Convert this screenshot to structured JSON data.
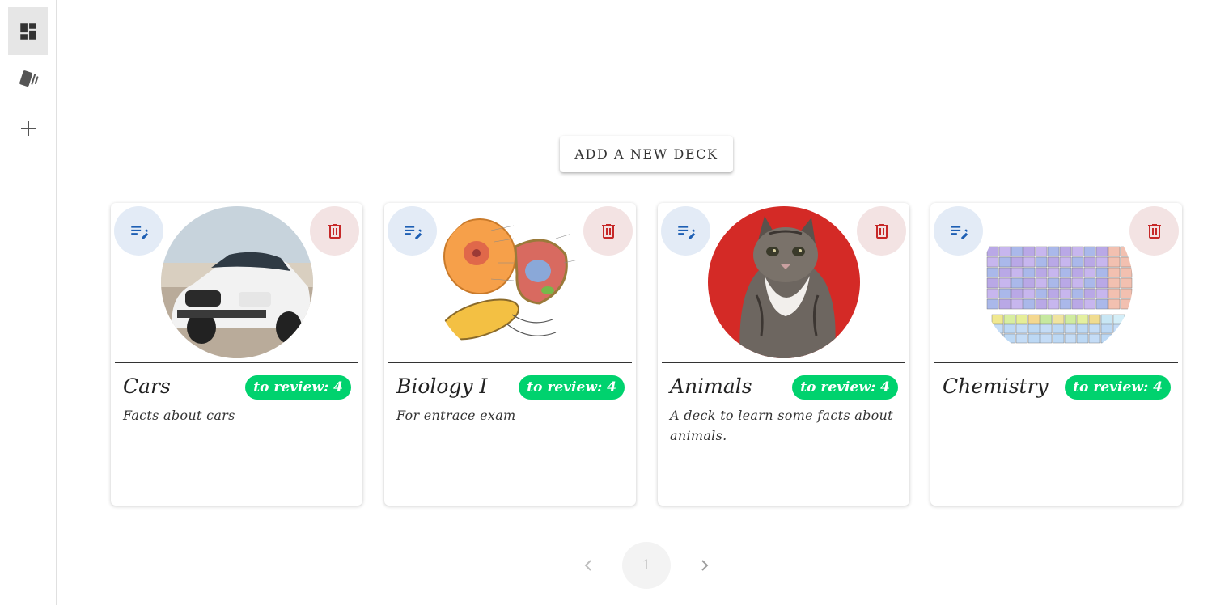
{
  "sidebar": {
    "items": [
      {
        "name": "dashboard-icon",
        "active": true
      },
      {
        "name": "decks-icon",
        "active": false
      },
      {
        "name": "plus-icon",
        "active": false
      }
    ]
  },
  "toolbar": {
    "add_deck_label": "ADD A NEW DECK"
  },
  "cards": [
    {
      "title": "Cars",
      "badge": "to review: 4",
      "description": "Facts about cars",
      "image": "car-photo"
    },
    {
      "title": "Biology I",
      "badge": "to review: 4",
      "description": "For entrace exam",
      "image": "cell-diagram"
    },
    {
      "title": "Animals",
      "badge": "to review: 4",
      "description": "A deck to learn some facts about animals.",
      "image": "kitten-photo"
    },
    {
      "title": "Chemistry",
      "badge": "to review: 4",
      "description": "",
      "image": "periodic-table"
    }
  ],
  "pagination": {
    "current_page": "1"
  },
  "colors": {
    "badge": "#00d26e",
    "edit_bg": "#e3ebf6",
    "delete_bg": "#f3e3e3",
    "edit_icon": "#1e5fb4",
    "delete_icon": "#c62828"
  }
}
